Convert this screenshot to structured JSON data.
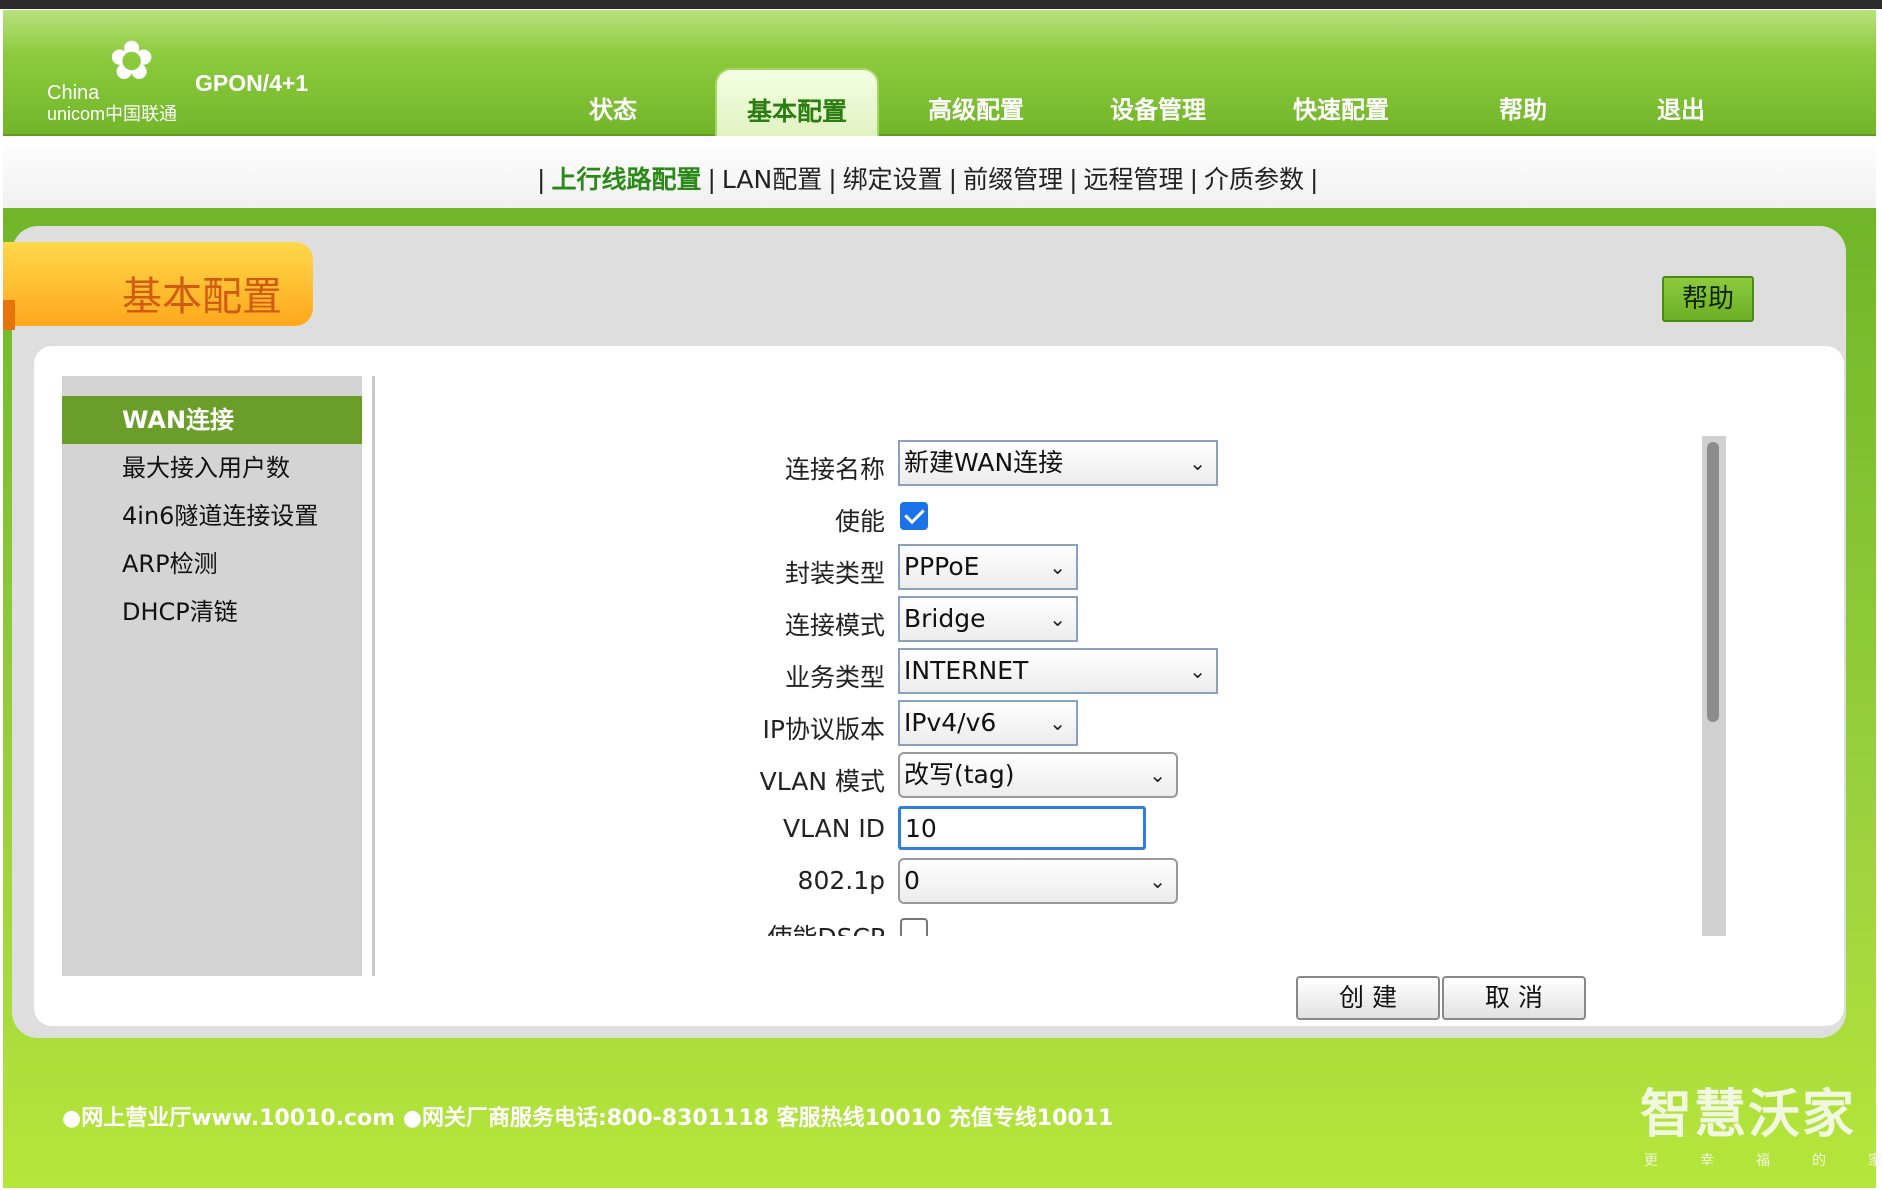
{
  "header": {
    "logo_china": "China",
    "logo_unicom": "unicom中国联通",
    "model": "GPON/4+1",
    "nav": [
      {
        "label": "状态"
      },
      {
        "label": "基本配置"
      },
      {
        "label": "高级配置"
      },
      {
        "label": "设备管理"
      },
      {
        "label": "快速配置"
      },
      {
        "label": "帮助"
      },
      {
        "label": "退出"
      }
    ],
    "active_nav": "基本配置"
  },
  "subnav": {
    "separator": "|",
    "items": [
      {
        "label": "上行线路配置"
      },
      {
        "label": "LAN配置"
      },
      {
        "label": "绑定设置"
      },
      {
        "label": "前缀管理"
      },
      {
        "label": "远程管理"
      },
      {
        "label": "介质参数"
      }
    ],
    "active": "上行线路配置"
  },
  "page": {
    "title": "基本配置",
    "help_button": "帮助"
  },
  "left_menu": {
    "items": [
      {
        "label": "WAN连接"
      },
      {
        "label": "最大接入用户数"
      },
      {
        "label": "4in6隧道连接设置"
      },
      {
        "label": "ARP检测"
      },
      {
        "label": "DHCP清链"
      }
    ],
    "active": "WAN连接"
  },
  "form": {
    "connection_name": {
      "label": "连接名称",
      "value": "新建WAN连接"
    },
    "enable": {
      "label": "使能",
      "checked": true
    },
    "encap_type": {
      "label": "封装类型",
      "value": "PPPoE"
    },
    "conn_mode": {
      "label": "连接模式",
      "value": "Bridge"
    },
    "service_type": {
      "label": "业务类型",
      "value": "INTERNET"
    },
    "ip_version": {
      "label": "IP协议版本",
      "value": "IPv4/v6"
    },
    "vlan_mode": {
      "label": "VLAN 模式",
      "value": "改写(tag)"
    },
    "vlan_id": {
      "label": "VLAN ID",
      "value": "10"
    },
    "p8021": {
      "label": "802.1p",
      "value": "0"
    },
    "dscp_enable": {
      "label": "使能DSCP",
      "checked": false
    }
  },
  "buttons": {
    "create": "创 建",
    "cancel": "取 消"
  },
  "footer": {
    "info": "●网上营业厅www.10010.com ●网关厂商服务电话:800-8301118 客服热线10010 充值专线10011",
    "brand": "智慧沃家",
    "slogan": "更幸福的家"
  },
  "colors": {
    "header_green": "#8ccb3d",
    "active_tab_text": "#2b7d12",
    "title_orange": "#ffa81c",
    "menu_active": "#6b9d2a",
    "checkbox_blue": "#1a73e8"
  }
}
